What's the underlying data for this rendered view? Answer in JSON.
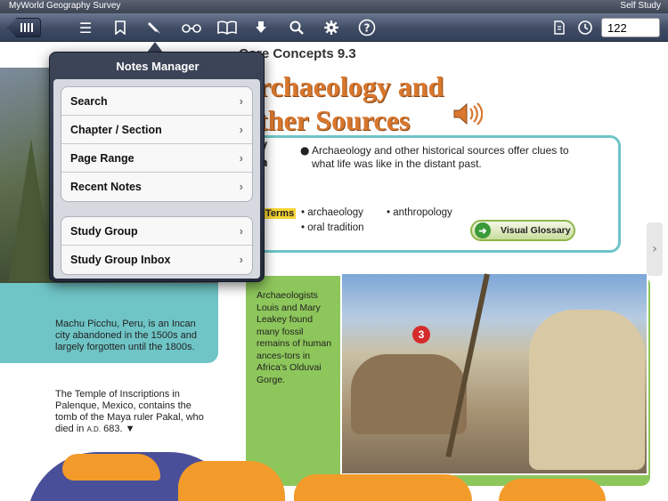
{
  "statusbar": {
    "app_name": "MyWorld Geography Survey",
    "mode": "Self Study"
  },
  "toolbar": {
    "icons": [
      "library-icon",
      "list-icon",
      "bookmark-icon",
      "pen-icon",
      "glasses-icon",
      "book-icon",
      "download-icon",
      "search-icon",
      "gear-icon",
      "help-icon",
      "page-icon",
      "history-icon"
    ],
    "page_number": "122"
  },
  "page": {
    "section_header": "Core Concepts 9.3",
    "title_line1": "rchaeology and",
    "title_line2": "ther Sources",
    "frag_y": "y",
    "frag_a": "a",
    "main_idea": "Archaeology and other historical sources offer clues to what life was like in the distant past.",
    "terms_label": "Terms",
    "terms": [
      "archaeology",
      "anthropology",
      "oral tradition"
    ],
    "visual_glossary": "Visual Glossary",
    "caption_machu": "Machu Picchu, Peru, is an Incan city abandoned in the 1500s and largely forgotten until the 1800s.",
    "caption_temple_main": "The Temple of Inscriptions in Palenque, Mexico, contains the tomb of the Maya ruler Pakal, who died in",
    "caption_temple_era": "A.D.",
    "caption_temple_year": "683.",
    "caption_leakey": "Archaeologists Louis and Mary Leakey found many fossil remains of human ances-tors in Africa's Olduvai Gorge.",
    "badge_number": "3",
    "title_color": "#d8772d",
    "accent_teal": "#6fc4c6",
    "accent_green": "#8dc65b"
  },
  "notes_manager": {
    "title": "Notes Manager",
    "group1": [
      "Search",
      "Chapter / Section",
      "Page Range",
      "Recent Notes"
    ],
    "group2": [
      "Study Group",
      "Study Group Inbox"
    ]
  }
}
